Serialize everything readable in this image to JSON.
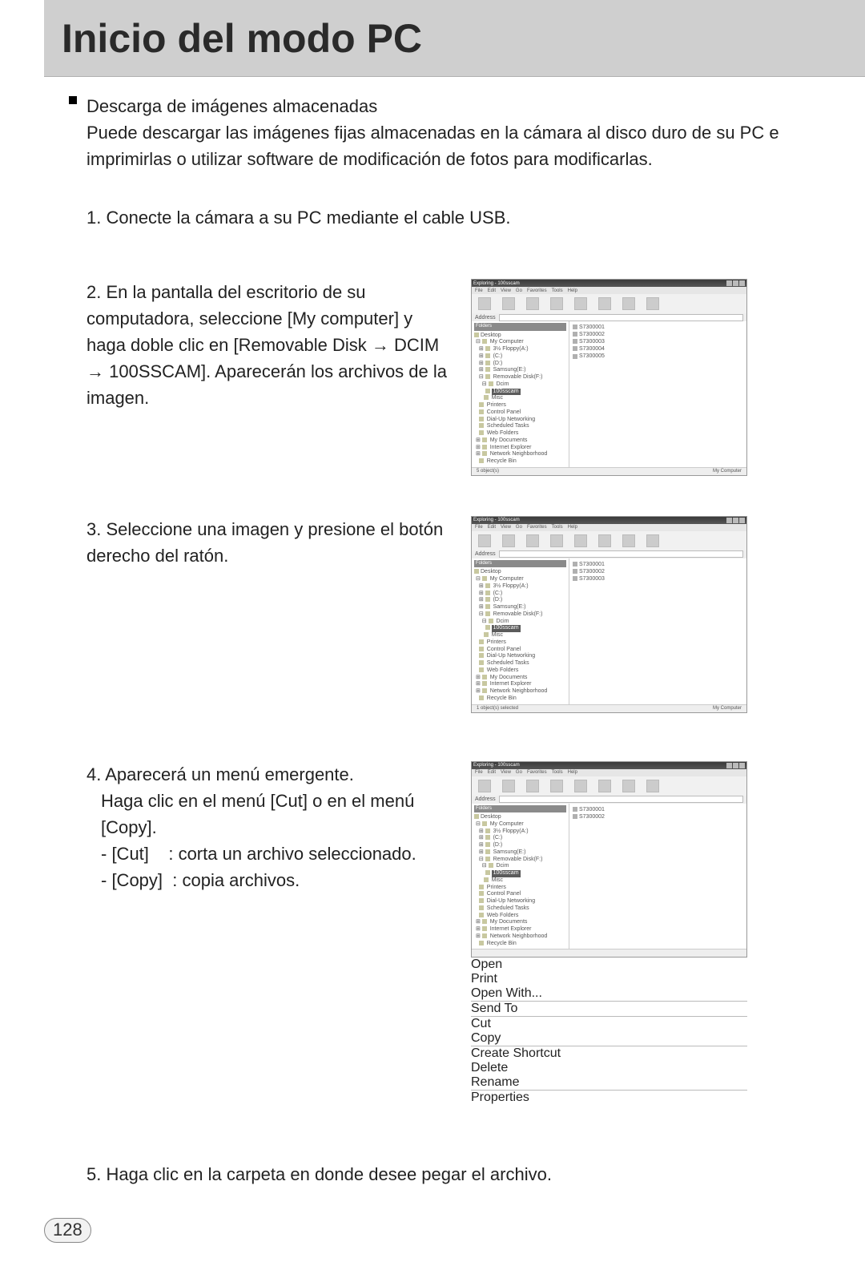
{
  "page": {
    "title": "Inicio del modo PC",
    "number": "128"
  },
  "intro": {
    "heading": "Descarga de imágenes almacenadas",
    "body": "Puede descargar las imágenes fijas almacenadas en la cámara al disco duro de su PC e imprimirlas o utilizar software de modificación de fotos para modificarlas."
  },
  "steps": {
    "s1": "1. Conecte la cámara a su PC mediante el cable USB.",
    "s2": "2. En la pantalla del escritorio de su computadora, seleccione [My computer] y haga doble clic en [Removable Disk → DCIM → 100SSCAM]. Aparecerán los archivos de la imagen.",
    "s3": "3. Seleccione una imagen y presione el botón derecho del ratón.",
    "s4a": "4. Aparecerá un menú emergente.",
    "s4b": "Haga clic en el menú [Cut] o en el menú [Copy].",
    "s4c": "- [Cut]    : corta un archivo seleccionado.",
    "s4d": "- [Copy]  : copia archivos.",
    "s5": "5. Haga clic en la carpeta en donde desee pegar el archivo."
  },
  "explorer": {
    "title": "Exploring - 100sscam",
    "menus": [
      "File",
      "Edit",
      "View",
      "Go",
      "Favorites",
      "Tools",
      "Help"
    ],
    "address_label": "Address",
    "tree_header": "Folders",
    "tree": [
      "Desktop",
      "  My Computer",
      "    3½ Floppy(A:)",
      "    (C:)",
      "    (D:)",
      "    Samsung(E:)",
      "    Removable Disk(F:)",
      "      Dcim",
      "        100sscam",
      "      Misc",
      "    Printers",
      "    Control Panel",
      "    Dial-Up Networking",
      "    Scheduled Tasks",
      "    Web Folders",
      "  My Documents",
      "  Internet Explorer",
      "  Network Neighborhood",
      "  Recycle Bin"
    ],
    "files": [
      "S7300001",
      "S7300002",
      "S7300003",
      "S7300004",
      "S7300005"
    ],
    "files3": [
      "S7300001",
      "S7300002",
      "S7300003"
    ],
    "status_left": "5 object(s)",
    "status_left3": "1 object(s) selected",
    "status_right": "My Computer",
    "context_menu": [
      "Open",
      "Print",
      "Open With...",
      "Send To",
      "Cut",
      "Copy",
      "Create Shortcut",
      "Delete",
      "Rename",
      "Properties"
    ]
  }
}
